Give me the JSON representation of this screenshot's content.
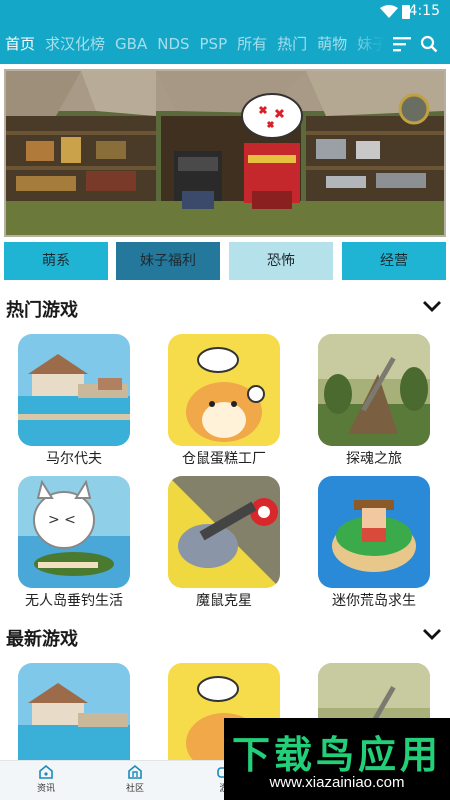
{
  "status": {
    "time": "4:15"
  },
  "nav": {
    "tabs": [
      "首页",
      "求汉化榜",
      "GBA",
      "NDS",
      "PSP",
      "所有",
      "热门",
      "萌物",
      "妹子"
    ],
    "active": 0
  },
  "chips": [
    "萌系",
    "妹子福利",
    "恐怖",
    "经营"
  ],
  "hot": {
    "title": "热门游戏",
    "games": [
      "马尔代夫",
      "仓鼠蛋糕工厂",
      "探魂之旅",
      "无人岛垂钓生活",
      "魔鼠克星",
      "迷你荒岛求生"
    ]
  },
  "latest": {
    "title": "最新游戏"
  },
  "bottom_nav": [
    "资讯",
    "社区",
    "游"
  ],
  "watermark": {
    "title": "下载鸟应用",
    "url": "www.xiazainiao.com"
  },
  "colors": {
    "primary": "#14a7c8",
    "chip_dark": "#24789b",
    "chip_light": "#b5e1ea"
  }
}
